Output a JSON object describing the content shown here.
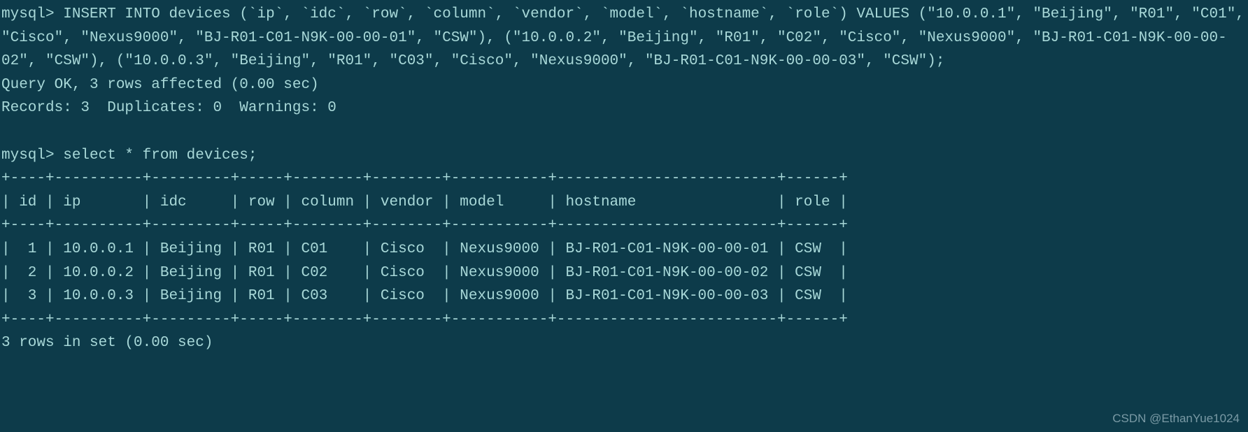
{
  "prompt1": "mysql> ",
  "insert_stmt": "INSERT INTO devices (`ip`, `idc`, `row`, `column`, `vendor`, `model`, `hostname`, `role`) VALUES (\"10.0.0.1\", \"Beijing\", \"R01\", \"C01\", \"Cisco\", \"Nexus9000\", \"BJ-R01-C01-N9K-00-00-01\", \"CSW\"), (\"10.0.0.2\", \"Beijing\", \"R01\", \"C02\", \"Cisco\", \"Nexus9000\", \"BJ-R01-C01-N9K-00-00-02\", \"CSW\"), (\"10.0.0.3\", \"Beijing\", \"R01\", \"C03\", \"Cisco\", \"Nexus9000\", \"BJ-R01-C01-N9K-00-00-03\", \"CSW\");",
  "query_ok": "Query OK, 3 rows affected (0.00 sec)",
  "records_line": "Records: 3  Duplicates: 0  Warnings: 0",
  "prompt2": "mysql> ",
  "select_stmt": "select * from devices;",
  "table_border": "+----+----------+---------+-----+--------+--------+-----------+-------------------------+------+",
  "table_header": "| id | ip       | idc     | row | column | vendor | model     | hostname                | role |",
  "table_row1": "|  1 | 10.0.0.1 | Beijing | R01 | C01    | Cisco  | Nexus9000 | BJ-R01-C01-N9K-00-00-01 | CSW  |",
  "table_row2": "|  2 | 10.0.0.2 | Beijing | R01 | C02    | Cisco  | Nexus9000 | BJ-R01-C01-N9K-00-00-02 | CSW  |",
  "table_row3": "|  3 | 10.0.0.3 | Beijing | R01 | C03    | Cisco  | Nexus9000 | BJ-R01-C01-N9K-00-00-03 | CSW  |",
  "rows_in_set": "3 rows in set (0.00 sec)",
  "watermark": "CSDN @EthanYue1024",
  "chart_data": {
    "type": "table",
    "title": "devices",
    "columns": [
      "id",
      "ip",
      "idc",
      "row",
      "column",
      "vendor",
      "model",
      "hostname",
      "role"
    ],
    "rows": [
      [
        1,
        "10.0.0.1",
        "Beijing",
        "R01",
        "C01",
        "Cisco",
        "Nexus9000",
        "BJ-R01-C01-N9K-00-00-01",
        "CSW"
      ],
      [
        2,
        "10.0.0.2",
        "Beijing",
        "R01",
        "C02",
        "Cisco",
        "Nexus9000",
        "BJ-R01-C01-N9K-00-00-02",
        "CSW"
      ],
      [
        3,
        "10.0.0.3",
        "Beijing",
        "R01",
        "C03",
        "Cisco",
        "Nexus9000",
        "BJ-R01-C01-N9K-00-00-03",
        "CSW"
      ]
    ]
  }
}
